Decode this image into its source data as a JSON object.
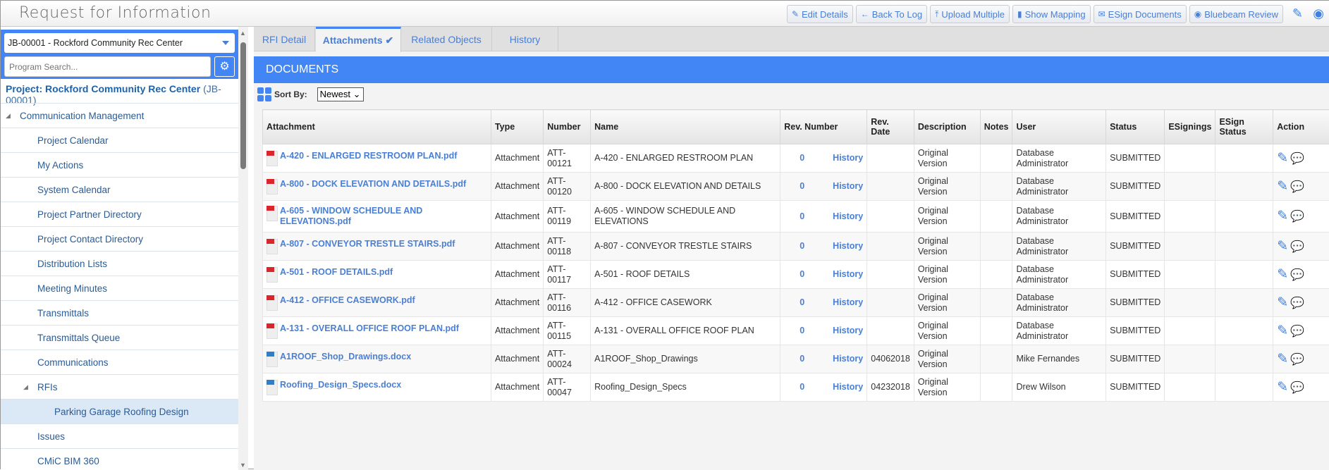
{
  "app": {
    "title": "Request for Information"
  },
  "toolbar": [
    {
      "label": "Edit Details",
      "icon": "pencil-icon"
    },
    {
      "label": "Back To Log",
      "icon": "arrow-left-icon"
    },
    {
      "label": "Upload Multiple",
      "icon": "upload-icon"
    },
    {
      "label": "Show Mapping",
      "icon": "map-icon"
    },
    {
      "label": "ESign Documents",
      "icon": "envelope-icon"
    },
    {
      "label": "Bluebeam Review",
      "icon": "eye-icon"
    }
  ],
  "sidebar": {
    "project_select": "JB-00001 - Rockford Community Rec Center",
    "search_placeholder": "Program Search...",
    "project_label": "Project: Rockford Community Rec Center",
    "project_code": "(JB-00001)",
    "items": [
      {
        "label": "Communication Management",
        "level": 0,
        "expanded": true
      },
      {
        "label": "Project Calendar",
        "level": 1
      },
      {
        "label": "My Actions",
        "level": 1
      },
      {
        "label": "System Calendar",
        "level": 1
      },
      {
        "label": "Project Partner Directory",
        "level": 1
      },
      {
        "label": "Project Contact Directory",
        "level": 1
      },
      {
        "label": "Distribution Lists",
        "level": 1
      },
      {
        "label": "Meeting Minutes",
        "level": 1
      },
      {
        "label": "Transmittals",
        "level": 1
      },
      {
        "label": "Transmittals Queue",
        "level": 1
      },
      {
        "label": "Communications",
        "level": 1
      },
      {
        "label": "RFIs",
        "level": 1,
        "expanded": true
      },
      {
        "label": "Parking Garage Roofing Design",
        "level": 2,
        "selected": true
      },
      {
        "label": "Issues",
        "level": 1
      },
      {
        "label": "CMiC BIM 360",
        "level": 1
      }
    ]
  },
  "tabs": [
    {
      "label": "RFI Detail"
    },
    {
      "label": "Attachments ✔",
      "active": true
    },
    {
      "label": "Related Objects"
    },
    {
      "label": "History"
    }
  ],
  "documents": {
    "title": "DOCUMENTS",
    "sort_label": "Sort By:",
    "sort_value": "Newest",
    "columns": [
      "Attachment",
      "Type",
      "Number",
      "Name",
      "Rev. Number",
      "Rev. Date",
      "Description",
      "Notes",
      "User",
      "Status",
      "ESignings",
      "ESign Status",
      "Action"
    ],
    "history_label": "History",
    "rows": [
      {
        "file": "A-420 - ENLARGED RESTROOM PLAN.pdf",
        "ftype": "pdf",
        "type": "Attachment",
        "number": "ATT-\n00121",
        "name": "A-420 - ENLARGED RESTROOM PLAN",
        "rev": "0",
        "rev_date": "",
        "description": "Original Version",
        "notes": "",
        "user": "Database Administrator",
        "status": "SUBMITTED",
        "esignings": "",
        "esign_status": ""
      },
      {
        "file": "A-800 - DOCK ELEVATION AND DETAILS.pdf",
        "ftype": "pdf",
        "type": "Attachment",
        "number": "ATT-\n00120",
        "name": "A-800 - DOCK ELEVATION AND DETAILS",
        "rev": "0",
        "rev_date": "",
        "description": "Original Version",
        "notes": "",
        "user": "Database Administrator",
        "status": "SUBMITTED",
        "esignings": "",
        "esign_status": ""
      },
      {
        "file": "A-605 - WINDOW SCHEDULE AND ELEVATIONS.pdf",
        "ftype": "pdf",
        "type": "Attachment",
        "number": "ATT-\n00119",
        "name": "A-605 - WINDOW SCHEDULE AND ELEVATIONS",
        "rev": "0",
        "rev_date": "",
        "description": "Original Version",
        "notes": "",
        "user": "Database Administrator",
        "status": "SUBMITTED",
        "esignings": "",
        "esign_status": ""
      },
      {
        "file": "A-807 - CONVEYOR TRESTLE STAIRS.pdf",
        "ftype": "pdf",
        "type": "Attachment",
        "number": "ATT-\n00118",
        "name": "A-807 - CONVEYOR TRESTLE STAIRS",
        "rev": "0",
        "rev_date": "",
        "description": "Original Version",
        "notes": "",
        "user": "Database Administrator",
        "status": "SUBMITTED",
        "esignings": "",
        "esign_status": ""
      },
      {
        "file": "A-501 - ROOF DETAILS.pdf",
        "ftype": "pdf",
        "type": "Attachment",
        "number": "ATT-\n00117",
        "name": "A-501 - ROOF DETAILS",
        "rev": "0",
        "rev_date": "",
        "description": "Original Version",
        "notes": "",
        "user": "Database Administrator",
        "status": "SUBMITTED",
        "esignings": "",
        "esign_status": ""
      },
      {
        "file": "A-412 - OFFICE CASEWORK.pdf",
        "ftype": "pdf",
        "type": "Attachment",
        "number": "ATT-\n00116",
        "name": "A-412 - OFFICE CASEWORK",
        "rev": "0",
        "rev_date": "",
        "description": "Original Version",
        "notes": "",
        "user": "Database Administrator",
        "status": "SUBMITTED",
        "esignings": "",
        "esign_status": ""
      },
      {
        "file": "A-131 - OVERALL OFFICE ROOF PLAN.pdf",
        "ftype": "pdf",
        "type": "Attachment",
        "number": "ATT-\n00115",
        "name": "A-131 - OVERALL OFFICE ROOF PLAN",
        "rev": "0",
        "rev_date": "",
        "description": "Original Version",
        "notes": "",
        "user": "Database Administrator",
        "status": "SUBMITTED",
        "esignings": "",
        "esign_status": ""
      },
      {
        "file": "A1ROOF_Shop_Drawings.docx",
        "ftype": "doc",
        "type": "Attachment",
        "number": "ATT-\n00024",
        "name": "A1ROOF_Shop_Drawings",
        "rev": "0",
        "rev_date": "04062018",
        "description": "Original Version",
        "notes": "",
        "user": "Mike Fernandes",
        "status": "SUBMITTED",
        "esignings": "",
        "esign_status": ""
      },
      {
        "file": "Roofing_Design_Specs.docx",
        "ftype": "doc",
        "type": "Attachment",
        "number": "ATT-\n00047",
        "name": "Roofing_Design_Specs",
        "rev": "0",
        "rev_date": "04232018",
        "description": "Original Version",
        "notes": "",
        "user": "Drew Wilson",
        "status": "SUBMITTED",
        "esignings": "",
        "esign_status": ""
      }
    ]
  },
  "colors": {
    "accent": "#4285f4",
    "link": "#4a7fd4",
    "pdf": "#d9252b",
    "doc": "#2f7fc8",
    "selected": "#dbe8f5"
  }
}
